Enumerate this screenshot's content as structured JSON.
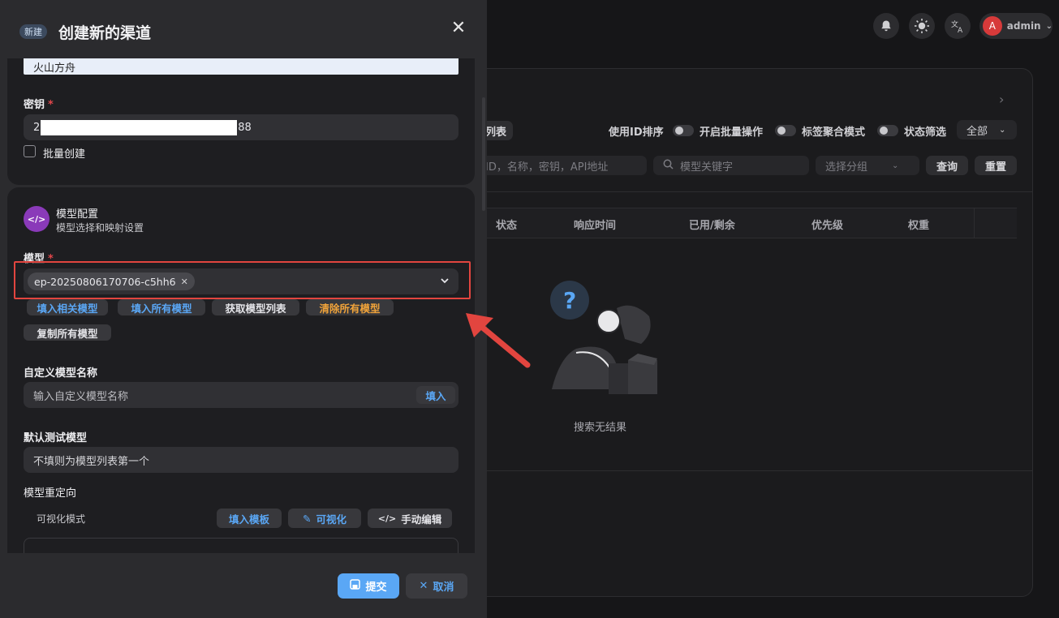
{
  "header": {
    "user_name": "admin",
    "avatar_letter": "A"
  },
  "toolbar": {
    "list_tab_fragment": "列表",
    "sort_by_id": "使用ID排序",
    "batch_ops": "开启批量操作",
    "tag_agg": "标签聚合模式",
    "status_filter": "状态筛选",
    "status_value": "全部",
    "search_placeholder": "ID，名称，密钥，API地址",
    "model_keyword_placeholder": "模型关键字",
    "group_placeholder": "选择分组",
    "query_button": "查询",
    "reset_button": "重置"
  },
  "table": {
    "columns": [
      "状态",
      "响应时间",
      "已用/剩余",
      "优先级",
      "权重"
    ],
    "empty_text": "搜索无结果"
  },
  "drawer": {
    "badge": "新建",
    "title": "创建新的渠道",
    "name_value": "火山方舟",
    "key_label": "密钥",
    "key_value_prefix": "2",
    "key_value_suffix": "88",
    "batch_create": "批量创建",
    "model_section_title": "模型配置",
    "model_section_subtitle": "模型选择和映射设置",
    "model_label": "模型",
    "model_tag": "ep-20250806170706-c5hh6",
    "fill_related": "填入相关模型",
    "fill_all": "填入所有模型",
    "fetch_list": "获取模型列表",
    "clear_all": "清除所有模型",
    "copy_all": "复制所有模型",
    "custom_model_label": "自定义模型名称",
    "custom_model_placeholder": "输入自定义模型名称",
    "fill_button": "填入",
    "default_test_label": "默认测试模型",
    "default_test_placeholder": "不填则为模型列表第一个",
    "redirect_label": "模型重定向",
    "visual_mode": "可视化模式",
    "fill_template": "填入模板",
    "visualize": "可视化",
    "manual_edit": "手动编辑",
    "submit": "提交",
    "cancel": "取消"
  },
  "colors": {
    "accent_blue": "#5aa7f5",
    "highlight_red": "#e2453f",
    "orange": "#f0a33a"
  }
}
